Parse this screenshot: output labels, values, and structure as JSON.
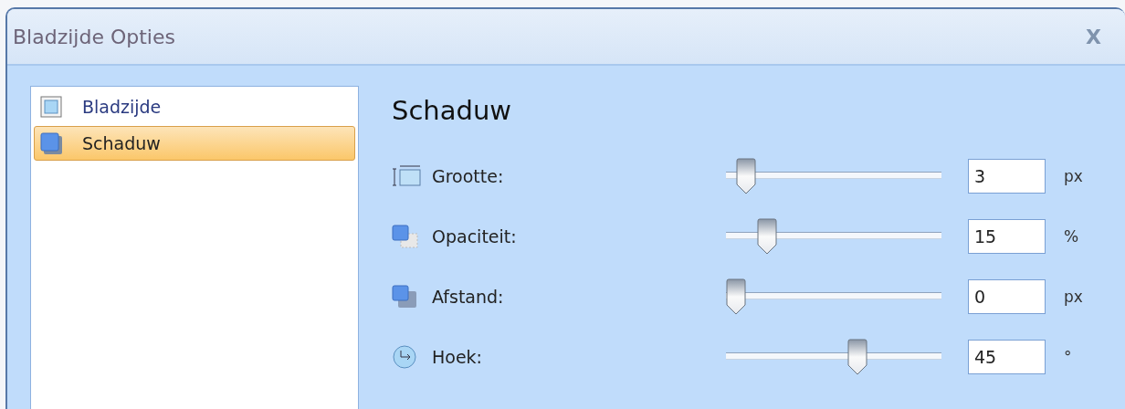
{
  "window": {
    "title": "Bladzijde Opties",
    "close": "X"
  },
  "sidebar": {
    "items": [
      {
        "label": "Bladzijde",
        "kind": "page",
        "selected": false
      },
      {
        "label": "Schaduw",
        "kind": "shadow",
        "selected": true
      }
    ]
  },
  "panel": {
    "heading": "Schaduw",
    "settings": [
      {
        "kind": "size",
        "label": "Grootte:",
        "level": 0.05,
        "value": "3",
        "unit": "px"
      },
      {
        "kind": "opacity",
        "label": "Opaciteit:",
        "level": 0.16,
        "value": "15",
        "unit": "%"
      },
      {
        "kind": "distance",
        "label": "Afstand:",
        "level": 0,
        "value": "0",
        "unit": "px"
      },
      {
        "kind": "angle",
        "label": "Hoek:",
        "level": 0.62,
        "value": "45",
        "unit": "°"
      }
    ]
  }
}
